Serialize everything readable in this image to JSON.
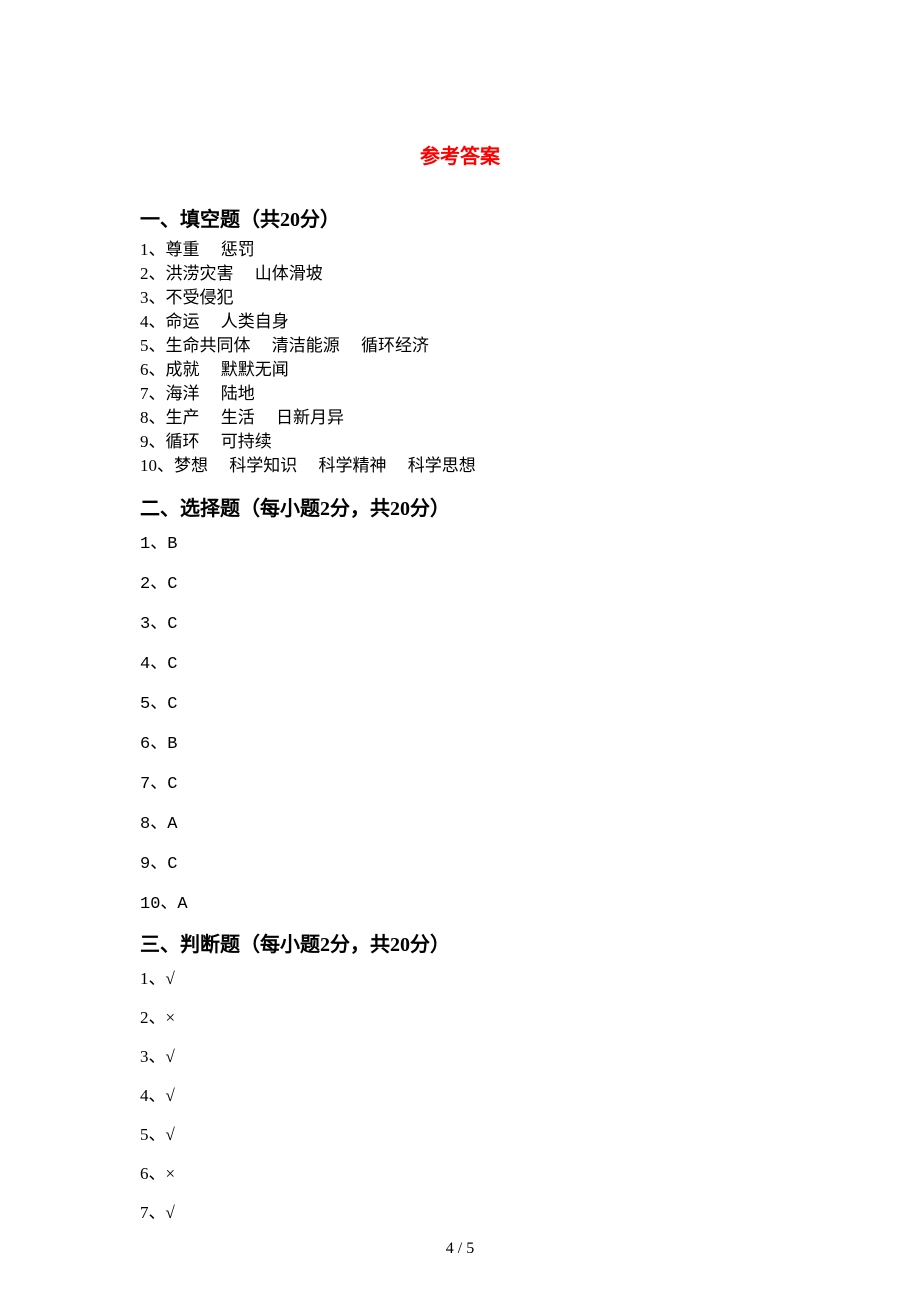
{
  "title": "参考答案",
  "pageNumber": "4 / 5",
  "sections": {
    "fill": {
      "heading": "一、填空题（共20分）",
      "items": [
        "1、尊重     惩罚",
        "2、洪涝灾害     山体滑坡",
        "3、不受侵犯",
        "4、命运     人类自身",
        "5、生命共同体     清洁能源     循环经济",
        "6、成就     默默无闻",
        "7、海洋     陆地",
        "8、生产     生活     日新月异",
        "9、循环     可持续",
        "10、梦想     科学知识     科学精神     科学思想"
      ]
    },
    "choice": {
      "heading": "二、选择题（每小题2分，共20分）",
      "items": [
        "1、B",
        "2、C",
        "3、C",
        "4、C",
        "5、C",
        "6、B",
        "7、C",
        "8、A",
        "9、C",
        "10、A"
      ]
    },
    "tf": {
      "heading": "三、判断题（每小题2分，共20分）",
      "items": [
        "1、√",
        "2、×",
        "3、√",
        "4、√",
        "5、√",
        "6、×",
        "7、√"
      ]
    }
  }
}
